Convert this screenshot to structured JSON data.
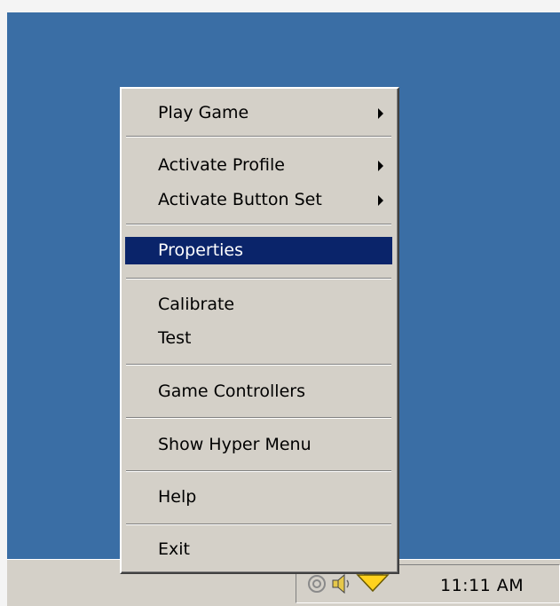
{
  "context_menu": {
    "items": [
      {
        "label": "Play Game",
        "submenu": true
      },
      {
        "label": "Activate Profile",
        "submenu": true
      },
      {
        "label": "Activate Button Set",
        "submenu": true
      },
      {
        "label": "Properties",
        "highlighted": true
      },
      {
        "label": "Calibrate"
      },
      {
        "label": "Test"
      },
      {
        "label": "Game Controllers"
      },
      {
        "label": "Show Hyper Menu"
      },
      {
        "label": "Help"
      },
      {
        "label": "Exit"
      }
    ]
  },
  "taskbar": {
    "clock": "11:11 AM",
    "tray_icons": [
      "device-icon",
      "speaker-icon",
      "joystick-icon"
    ]
  },
  "colors": {
    "desktop": "#3a6ea5",
    "menu_background": "#d4d0c8",
    "highlight": "#0a246a"
  }
}
